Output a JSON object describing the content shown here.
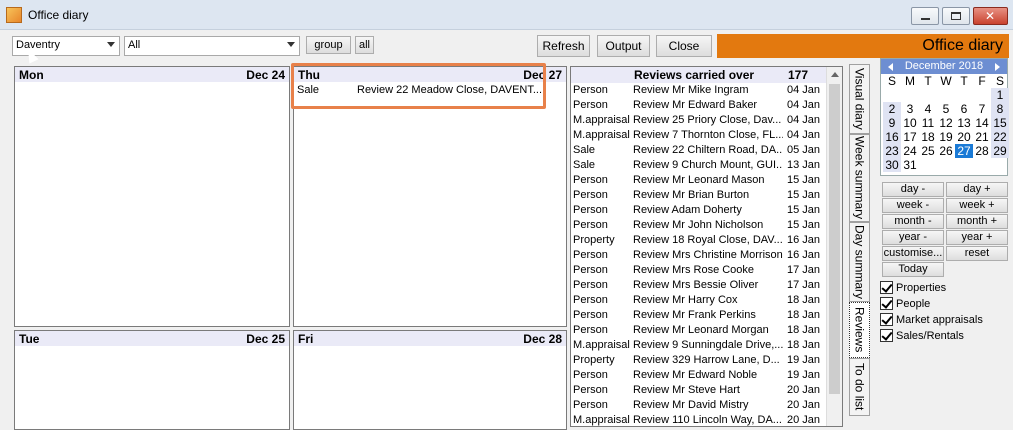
{
  "window": {
    "title": "Office diary"
  },
  "toolbar": {
    "branch_value": "Daventry",
    "filter_value": "All",
    "group_label": "group",
    "all_label": "all",
    "refresh_label": "Refresh",
    "output_label": "Output",
    "close_label": "Close",
    "brand_label": "Office diary"
  },
  "days": [
    {
      "day": "Mon",
      "date": "Dec 24",
      "entries": []
    },
    {
      "day": "Thu",
      "date": "Dec 27",
      "entries": [
        {
          "type": "Sale",
          "text": "Review 22 Meadow Close, DAVENT..."
        }
      ]
    },
    {
      "day": "Tue",
      "date": "Dec 25",
      "entries": []
    },
    {
      "day": "Fri",
      "date": "Dec 28",
      "entries": []
    }
  ],
  "reviews": {
    "title": "Reviews carried over",
    "count": "177",
    "rows": [
      [
        "Person",
        "Review Mr Mike Ingram",
        "04 Jan"
      ],
      [
        "Person",
        "Review Mr Edward Baker",
        "04 Jan"
      ],
      [
        "M.appraisal",
        "Review 25 Priory Close, Dav...",
        "04 Jan"
      ],
      [
        "M.appraisal",
        "Review 7 Thornton Close, FL...",
        "04 Jan"
      ],
      [
        "Sale",
        "Review 22 Chiltern Road, DA...",
        "05 Jan"
      ],
      [
        "Sale",
        "Review 9 Church Mount, GUI...",
        "13 Jan"
      ],
      [
        "Person",
        "Review Mr Leonard Mason",
        "15 Jan"
      ],
      [
        "Person",
        "Review Mr Brian Burton",
        "15 Jan"
      ],
      [
        "Person",
        "Review Adam Doherty",
        "15 Jan"
      ],
      [
        "Person",
        "Review Mr John Nicholson",
        "15 Jan"
      ],
      [
        "Property",
        "Review 18 Royal Close, DAV...",
        "16 Jan"
      ],
      [
        "Person",
        "Review Mrs Christine Morrison",
        "16 Jan"
      ],
      [
        "Person",
        "Review Mrs Rose Cooke",
        "17 Jan"
      ],
      [
        "Person",
        "Review Mrs Bessie Oliver",
        "17 Jan"
      ],
      [
        "Person",
        "Review Mr Harry Cox",
        "18 Jan"
      ],
      [
        "Person",
        "Review Mr Frank Perkins",
        "18 Jan"
      ],
      [
        "Person",
        "Review Mr Leonard Morgan",
        "18 Jan"
      ],
      [
        "M.appraisal",
        "Review 9 Sunningdale Drive,...",
        "18 Jan"
      ],
      [
        "Property",
        "Review 329 Harrow Lane, D...",
        "19 Jan"
      ],
      [
        "Person",
        "Review Mr Edward Noble",
        "19 Jan"
      ],
      [
        "Person",
        "Review Mr Steve Hart",
        "20 Jan"
      ],
      [
        "Person",
        "Review Mr David Mistry",
        "20 Jan"
      ],
      [
        "M.appraisal",
        "Review 110 Lincoln Way, DA...",
        "20 Jan"
      ]
    ]
  },
  "tabs": [
    "Visual diary",
    "Week summary",
    "Day summary",
    "Reviews",
    "To do list"
  ],
  "calendar": {
    "month_label": "December 2018",
    "weekdays": [
      "S",
      "M",
      "T",
      "W",
      "T",
      "F",
      "S"
    ],
    "cells": [
      "",
      "",
      "",
      "",
      "",
      "",
      "1",
      "2",
      "3",
      "4",
      "5",
      "6",
      "7",
      "8",
      "9",
      "10",
      "11",
      "12",
      "13",
      "14",
      "15",
      "16",
      "17",
      "18",
      "19",
      "20",
      "21",
      "22",
      "23",
      "24",
      "25",
      "26",
      "27",
      "28",
      "29",
      "30",
      "31",
      "",
      "",
      "",
      "",
      ""
    ],
    "selected": "27"
  },
  "nav_buttons": {
    "day_minus": "day -",
    "day_plus": "day +",
    "week_minus": "week -",
    "week_plus": "week +",
    "month_minus": "month -",
    "month_plus": "month +",
    "year_minus": "year -",
    "year_plus": "year +",
    "customise": "customise...",
    "reset": "reset",
    "today": "Today"
  },
  "checkboxes": [
    "Properties",
    "People",
    "Market appraisals",
    "Sales/Rentals"
  ],
  "colors": {
    "brand": "#e3790f",
    "highlight": "#e8814a",
    "calendar_header": "#6d8ed2",
    "selected_day": "#1a7ad6"
  }
}
